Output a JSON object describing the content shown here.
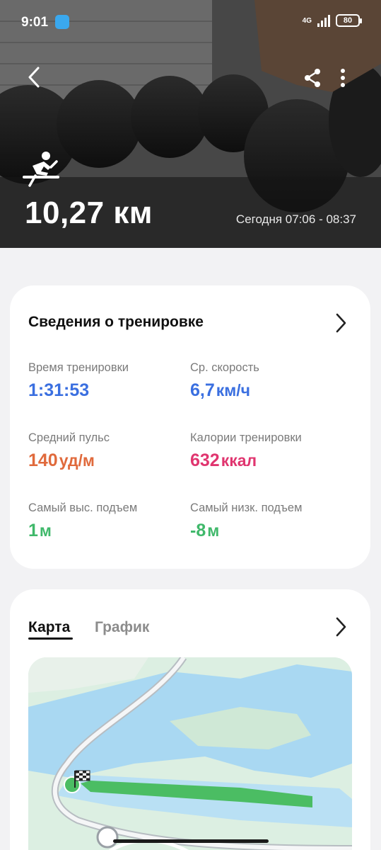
{
  "status_bar": {
    "time": "9:01",
    "network": "4G",
    "battery": "80"
  },
  "hero": {
    "activity_icon": "rowing-icon",
    "distance": "10,27 км",
    "time_range": "Сегодня 07:06 - 08:37"
  },
  "details": {
    "title": "Сведения о тренировке",
    "metrics": [
      {
        "label": "Время тренировки",
        "value": "1:31:53",
        "unit": "",
        "color": "#3a6fe0"
      },
      {
        "label": "Ср. скорость",
        "value": "6,7",
        "unit": "км/ч",
        "color": "#3a6fe0"
      },
      {
        "label": "Средний пульс",
        "value": "140",
        "unit": "уд/м",
        "color": "#e06a3c"
      },
      {
        "label": "Калории тренировки",
        "value": "632",
        "unit": "ккал",
        "color": "#e0356f"
      },
      {
        "label": "Самый выс. подъем",
        "value": "1",
        "unit": "м",
        "color": "#3fb86a"
      },
      {
        "label": "Самый низк. подъем",
        "value": "-8",
        "unit": "м",
        "color": "#3fb86a"
      }
    ]
  },
  "map_section": {
    "tabs": [
      {
        "label": "Карта",
        "active": true
      },
      {
        "label": "График",
        "active": false
      }
    ]
  },
  "icons": [
    "back-icon",
    "share-icon",
    "more-icon",
    "rowing-icon",
    "chevron-right-icon",
    "finish-flag-icon"
  ],
  "colors": {
    "route": "#4bbd63",
    "water": "#a9d8f2",
    "land": "#d9ede0"
  }
}
